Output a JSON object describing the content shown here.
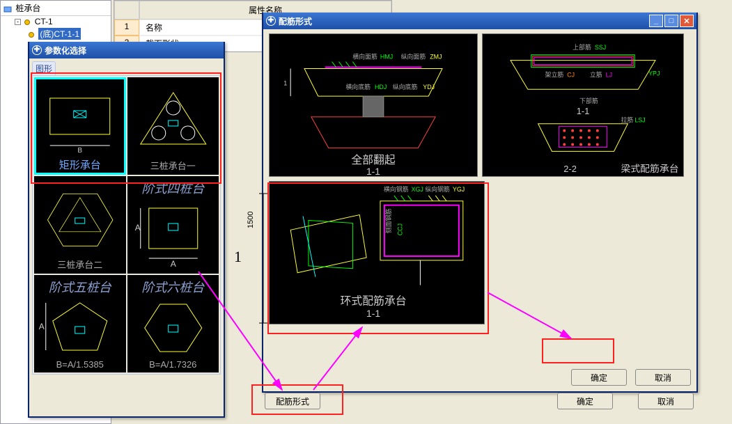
{
  "tree": {
    "root": "桩承台",
    "child1": "CT-1",
    "child2": "(底)CT-1-1"
  },
  "prop_grid": {
    "header_col1": "",
    "header_col2": "属性名称",
    "row1_idx": "1",
    "row1_name": "名称",
    "row2_idx": "2",
    "row2_name": "截面形状"
  },
  "param_dialog": {
    "title": "参数化选择",
    "group_label": "图形",
    "thumbs": {
      "rect": "矩形承台",
      "rect_dim": "B",
      "tri1": "三桩承台一",
      "tri2": "三桩承台二",
      "step4_title": "阶式四桩台",
      "step4_dim": "A",
      "step5_title": "阶式五桩台",
      "step5_formula": "B=A/1.5385",
      "step6_title": "阶式六桩台",
      "step6_formula": "B=A/1.7326"
    }
  },
  "rebar_dialog": {
    "title": "配筋形式",
    "axis_dim": "1500",
    "axis_label": "1",
    "pv1_labels": {
      "hmj": "横向面筋HMJ",
      "zmj": "纵向面筋ZMJ",
      "hdj": "横向底筋HDJ",
      "zdj": "纵向底筋 YDJ",
      "caption": "全部翻起",
      "section": "1-1"
    },
    "pv2_labels": {
      "ssj": "上部筋 SSJ",
      "cj": "架立筋 CJ",
      "lj": "立筋LJ",
      "ypj": "YPJ",
      "section1": "1-1",
      "la": "拉筋LSJ",
      "section2": "2-2",
      "caption": "梁式配筋承台"
    },
    "pv3_labels": {
      "hgj": "横向钢筋XGJ",
      "zgj": "纵向钢筋YGJ",
      "side": "侧面钢筋",
      "ccj": "CCJ",
      "caption": "环式配筋承台",
      "section": "1-1"
    },
    "ok": "确定",
    "cancel": "取消"
  },
  "bottom": {
    "rebar_style": "配筋形式",
    "ok": "确定",
    "cancel": "取消"
  }
}
